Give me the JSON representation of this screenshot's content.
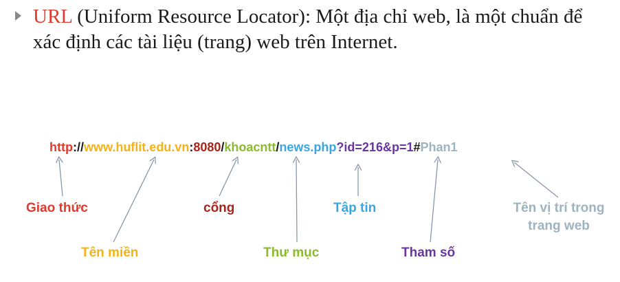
{
  "bullet": {
    "term": "URL",
    "text": " (Uniform Resource Locator): Một địa chỉ web, là một chuẩn để xác định các tài liệu (trang) web trên Internet."
  },
  "url_parts": [
    {
      "text": "http",
      "color": "#e03a2e"
    },
    {
      "text": "://",
      "color": "#1a1a1a"
    },
    {
      "text": "www.huflit.edu.vn",
      "color": "#f2b21a"
    },
    {
      "text": ":",
      "color": "#1a1a1a"
    },
    {
      "text": "8080",
      "color": "#a6261b"
    },
    {
      "text": "/",
      "color": "#1a1a1a"
    },
    {
      "text": "khoacntt",
      "color": "#8cba2e"
    },
    {
      "text": "/",
      "color": "#1a1a1a"
    },
    {
      "text": "news.php",
      "color": "#3aa6e0"
    },
    {
      "text": "?id=216&p=1",
      "color": "#6a35a0"
    },
    {
      "text": "#",
      "color": "#1a1a1a"
    },
    {
      "text": "Phan1",
      "color": "#9db4c0"
    }
  ],
  "labels": {
    "protocol": {
      "text": "Giao thức",
      "color": "#e03a2e"
    },
    "domain": {
      "text": "Tên miền",
      "color": "#f2b21a"
    },
    "port": {
      "text": "cổng",
      "color": "#a6261b"
    },
    "directory": {
      "text": "Thư mục",
      "color": "#8cba2e"
    },
    "file": {
      "text": "Tập tin",
      "color": "#3aa6e0"
    },
    "params": {
      "text": "Tham số",
      "color": "#6a35a0"
    },
    "anchor_line1": {
      "text": "Tên vị trí trong",
      "color": "#9db4c0"
    },
    "anchor_line2": {
      "text": "trang web",
      "color": "#9db4c0"
    }
  },
  "colors": {
    "arrow": "#8a96a8",
    "bullet_marker": "#8a8a8a"
  }
}
